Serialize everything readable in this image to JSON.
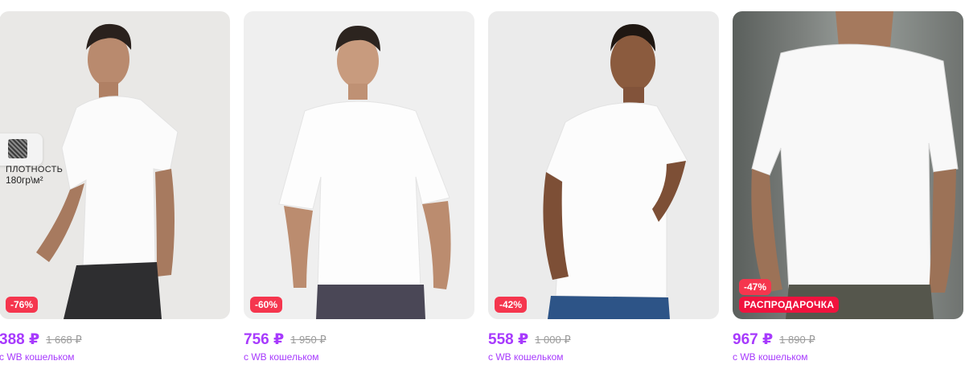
{
  "products": [
    {
      "price": "388 ₽",
      "old_price": "1 668 ₽",
      "discount": "-76%",
      "wallet_note": "с WB кошельком",
      "badge": {
        "label": "ПЛОТНОСТЬ",
        "value": "180гр\\м²"
      }
    },
    {
      "price": "756 ₽",
      "old_price": "1 950 ₽",
      "discount": "-60%",
      "wallet_note": "с WB кошельком"
    },
    {
      "price": "558 ₽",
      "old_price": "1 000 ₽",
      "discount": "-42%",
      "wallet_note": "с WB кошельком"
    },
    {
      "price": "967 ₽",
      "old_price": "1 890 ₽",
      "discount": "-47%",
      "promo": "РАСПРОДАРОЧКА",
      "wallet_note": "с WB кошельком"
    }
  ],
  "colors": {
    "price": "#a73afd",
    "discount_bg": "#f5364e",
    "promo_bg": "#f0133e"
  }
}
